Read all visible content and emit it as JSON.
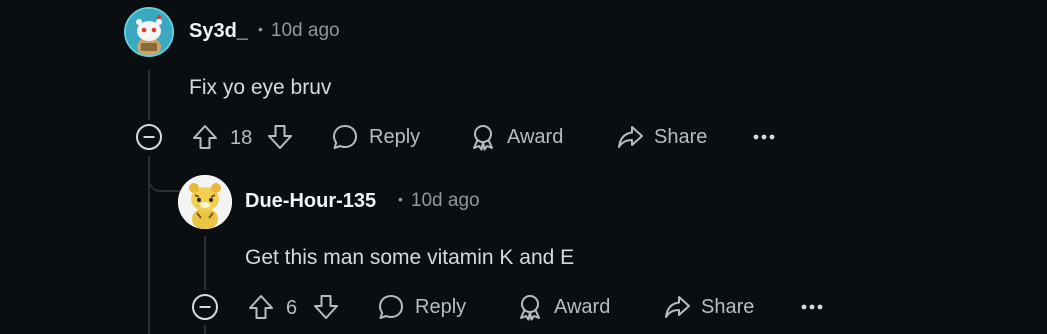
{
  "comments": [
    {
      "username": "Sy3d_",
      "time": "10d ago",
      "text": "Fix yo eye bruv",
      "votes": "18",
      "actions": {
        "reply": "Reply",
        "award": "Award",
        "share": "Share"
      }
    },
    {
      "username": "Due-Hour-135",
      "time": "10d ago",
      "text": "Get this man some vitamin K and E",
      "votes": "6",
      "actions": {
        "reply": "Reply",
        "award": "Award",
        "share": "Share"
      }
    }
  ],
  "colors": {
    "background": "#0b0e11",
    "text": "#d7dadc",
    "muted": "#8f979b",
    "thread_line": "#2a2f33"
  },
  "icons": [
    "upvote-icon",
    "downvote-icon",
    "comment-icon",
    "award-icon",
    "share-icon",
    "more-icon",
    "collapse-icon"
  ]
}
